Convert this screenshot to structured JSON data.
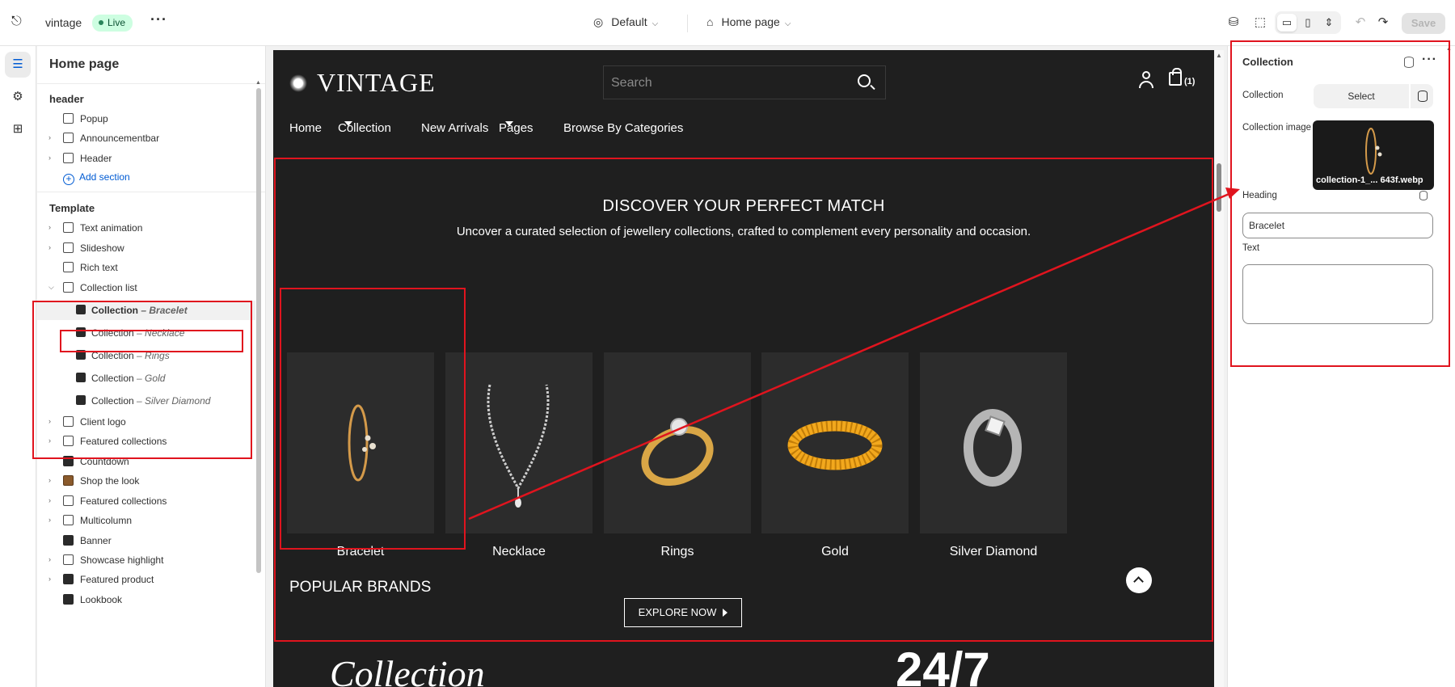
{
  "topbar": {
    "store_name": "vintage",
    "status": "Live",
    "theme": "Default",
    "page": "Home page",
    "save_label": "Save"
  },
  "sidebar": {
    "title": "Home page",
    "header_group": "header",
    "header_items": [
      "Popup",
      "Announcementbar",
      "Header"
    ],
    "add_section": "Add section",
    "template_group": "Template",
    "template_items": [
      "Text animation",
      "Slideshow",
      "Rich text",
      "Collection list"
    ],
    "collection_children": [
      {
        "label": "Collection",
        "sub": "– Bracelet"
      },
      {
        "label": "Collection",
        "sub": "– Necklace"
      },
      {
        "label": "Collection",
        "sub": "– Rings"
      },
      {
        "label": "Collection",
        "sub": "– Gold"
      },
      {
        "label": "Collection",
        "sub": "– Silver Diamond"
      }
    ],
    "after_items": [
      "Client logo",
      "Featured collections",
      "Countdown",
      "Shop the look",
      "Featured collections",
      "Multicolumn",
      "Banner",
      "Showcase highlight",
      "Featured product",
      "Lookbook"
    ]
  },
  "preview": {
    "logo": "VINTAGE",
    "search_placeholder": "Search",
    "cart_count": "(1)",
    "nav": [
      "Home",
      "Collection",
      "New Arrivals",
      "Pages",
      "Browse By Categories"
    ],
    "heading": "DISCOVER YOUR PERFECT MATCH",
    "subheading": "Uncover a curated selection of jewellery collections, crafted to complement every personality and occasion.",
    "collections": [
      "Bracelet",
      "Necklace",
      "Rings",
      "Gold",
      "Silver Diamond"
    ],
    "cta": "EXPLORE NOW",
    "next_section": "POPULAR BRANDS",
    "partial_text_left": "Collection",
    "partial_text_right": "24/7"
  },
  "panel": {
    "title": "Collection",
    "collection_label": "Collection",
    "select_label": "Select",
    "image_label": "Collection image",
    "image_filename": "collection-1_... 643f.webp",
    "heading_label": "Heading",
    "heading_value": "Bracelet",
    "text_label": "Text",
    "text_value": ""
  },
  "colors": {
    "accent": "#005bd3",
    "annotation": "#e0141e",
    "live_bg": "#cdfee1",
    "preview_bg": "#1f1f1f"
  }
}
